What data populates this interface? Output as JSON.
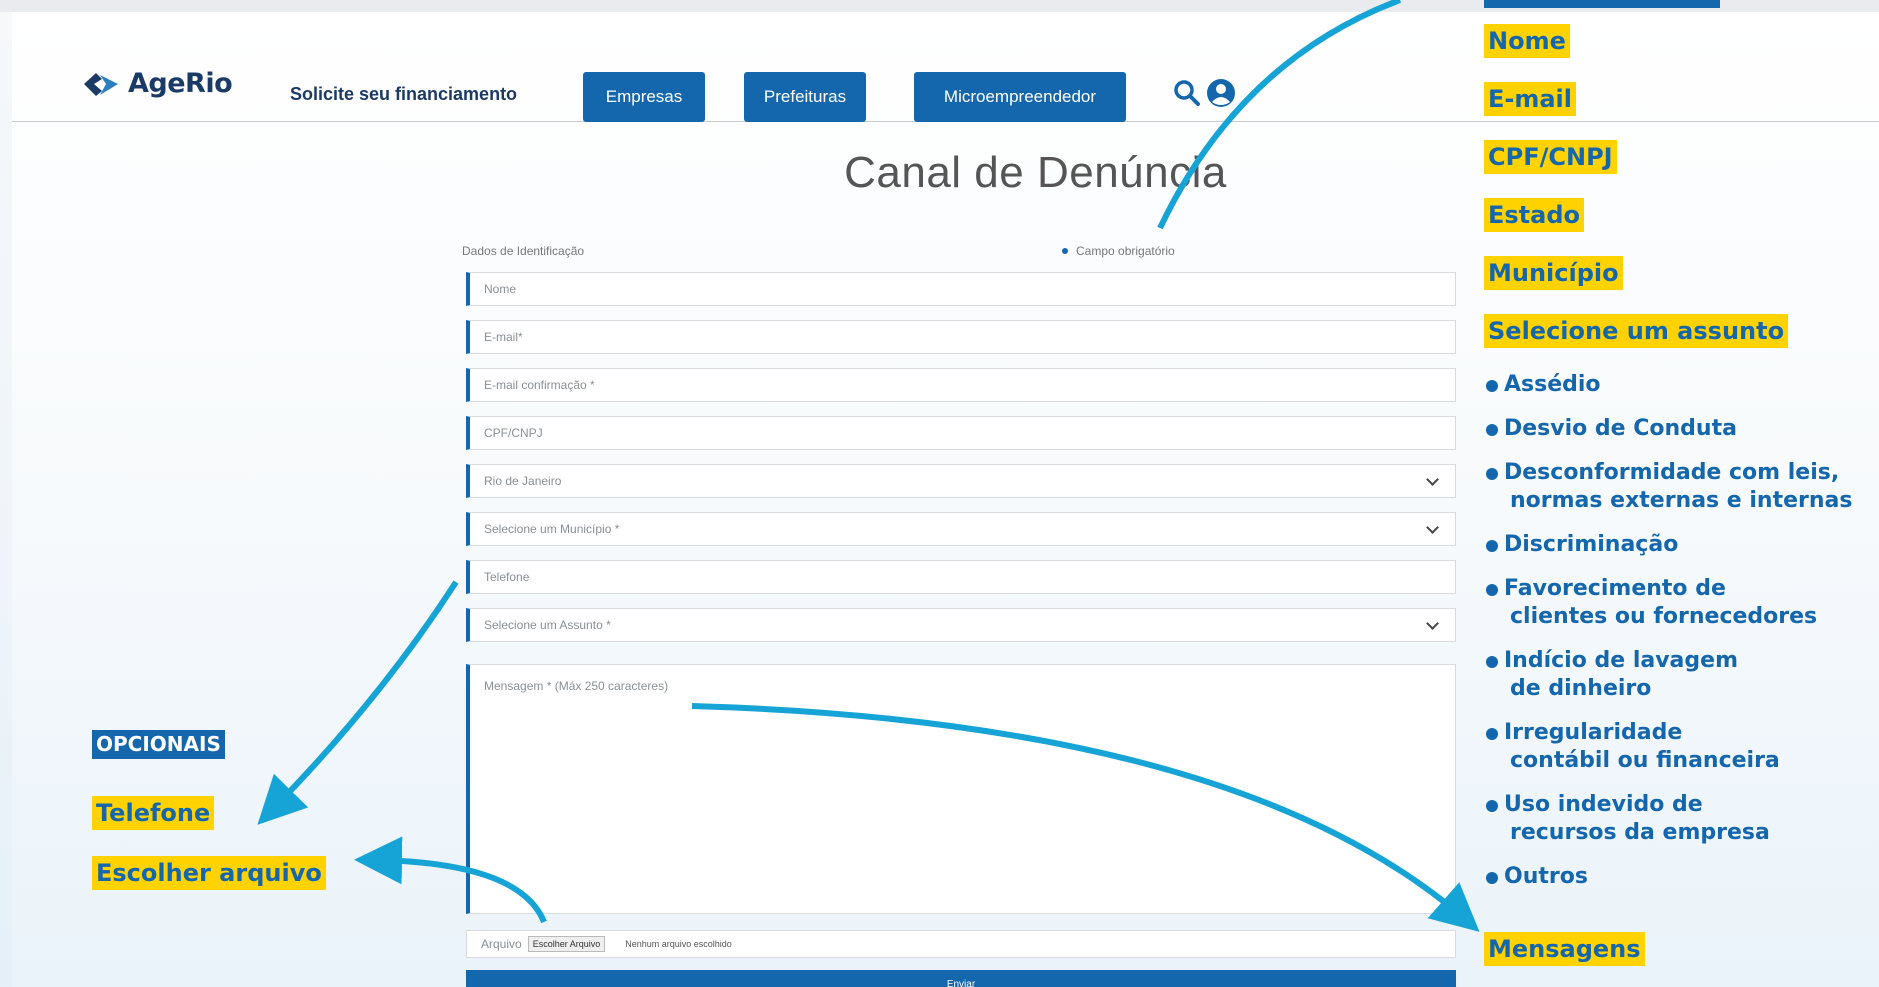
{
  "header": {
    "logo_text": "AgeRio",
    "link": "Solicite seu financiamento",
    "nav": [
      "Empresas",
      "Prefeituras",
      "Microempreendedor"
    ]
  },
  "page_title": "Canal de Denúncia",
  "form": {
    "section_label": "Dados de Identificação",
    "required_note": "Campo obrigatório",
    "fields": {
      "nome": "Nome",
      "email": "E-mail*",
      "email_confirm": "E-mail confirmação *",
      "cpf": "CPF/CNPJ",
      "estado": "Rio de Janeiro",
      "municipio": "Selecione um Município *",
      "telefone": "Telefone",
      "assunto": "Selecione um Assunto *",
      "mensagem": "Mensagem * (Máx 250 caracteres)"
    },
    "file_label": "Arquivo",
    "file_button": "Escolher Arquivo",
    "file_none": "Nenhum arquivo escolhido",
    "submit": "Enviar"
  },
  "annotations": {
    "required_header": "",
    "required": [
      "Nome",
      "E-mail",
      "CPF/CNPJ",
      "Estado",
      "Município",
      "Selecione um assunto"
    ],
    "subjects": [
      "Assédio",
      "Desvio de Conduta",
      "Desconformidade com leis,",
      "normas externas e internas",
      "Discriminação",
      "Favorecimento de",
      "clientes ou fornecedores",
      "Indício de lavagem",
      "de dinheiro",
      "Irregularidade",
      "contábil ou financeira",
      "Uso indevido de",
      "recursos da empresa",
      "Outros"
    ],
    "messages": "Mensagens",
    "optional_header": "OPCIONAIS",
    "optional": [
      "Telefone",
      "Escolher arquivo"
    ]
  },
  "colors": {
    "primary": "#1466ad",
    "highlight": "#ffd200",
    "navy": "#1b3a66"
  }
}
